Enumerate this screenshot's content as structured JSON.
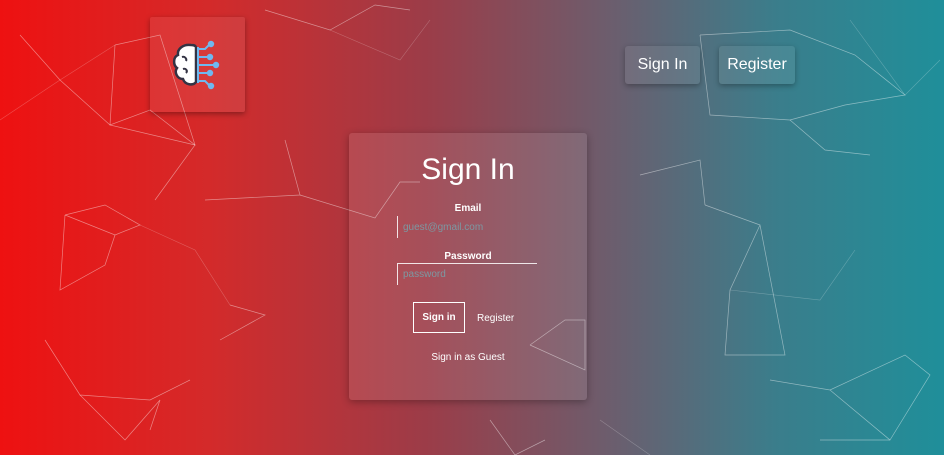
{
  "header": {
    "logo": {
      "icon": "brain-circuit-icon",
      "colors": {
        "brain": "#ffffff",
        "circuit": "#6fb8f0",
        "outline": "#333344"
      }
    },
    "nav": {
      "sign_in_label": "Sign In",
      "register_label": "Register"
    }
  },
  "form": {
    "title": "Sign In",
    "email_label": "Email",
    "email_placeholder": "guest@gmail.com",
    "password_label": "Password",
    "password_placeholder": "password",
    "sign_in_button": "Sign in",
    "register_link": "Register",
    "guest_link": "Sign in as Guest"
  },
  "theme": {
    "gradient_left": "#ee1111",
    "gradient_right": "#1f8f9a"
  }
}
